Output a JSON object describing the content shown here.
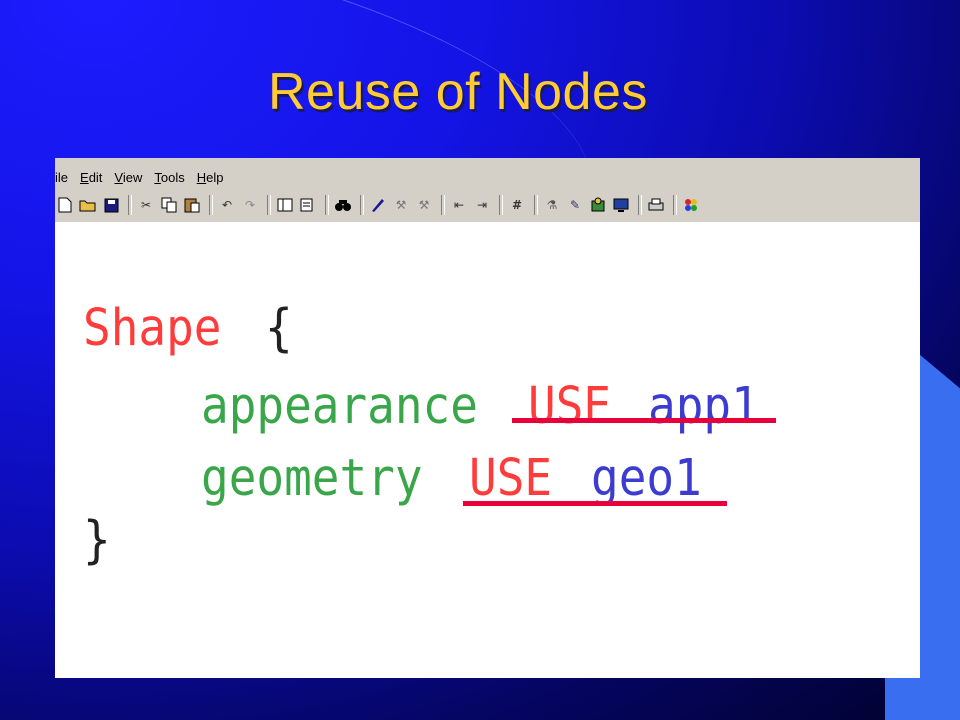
{
  "slide": {
    "title": "Reuse of Nodes"
  },
  "menu": {
    "file": "ile",
    "edit_u": "E",
    "edit": "dit",
    "view_u": "V",
    "view": "iew",
    "tools_u": "T",
    "tools": "ools",
    "help_u": "H",
    "help": "elp"
  },
  "toolbar": {
    "icons": [
      "new-icon",
      "open-icon",
      "save-icon",
      "cut-icon",
      "copy-icon",
      "paste-icon",
      "undo-icon",
      "redo-icon",
      "view1-icon",
      "view2-icon",
      "find-icon",
      "tool1-icon",
      "tool2-icon",
      "tool3-icon",
      "outdent-icon",
      "indent-icon",
      "hash-icon",
      "tool4-icon",
      "tool5-icon",
      "tool6-icon",
      "monitor-icon",
      "print-icon",
      "colors-icon"
    ]
  },
  "code": {
    "line1_keyword": "Shape",
    "line1_brace": "{",
    "line2_field": "appearance",
    "line2_use": "USE",
    "line2_name": "app1",
    "line3_field": "geometry",
    "line3_use": "USE",
    "line3_name": "geo1",
    "line4_brace": "}"
  },
  "colors": {
    "keyword": "#ff3c3c",
    "field": "#3aa64a",
    "name": "#3c3cd0",
    "underline": "#e8003a",
    "title": "#ffcc33"
  }
}
